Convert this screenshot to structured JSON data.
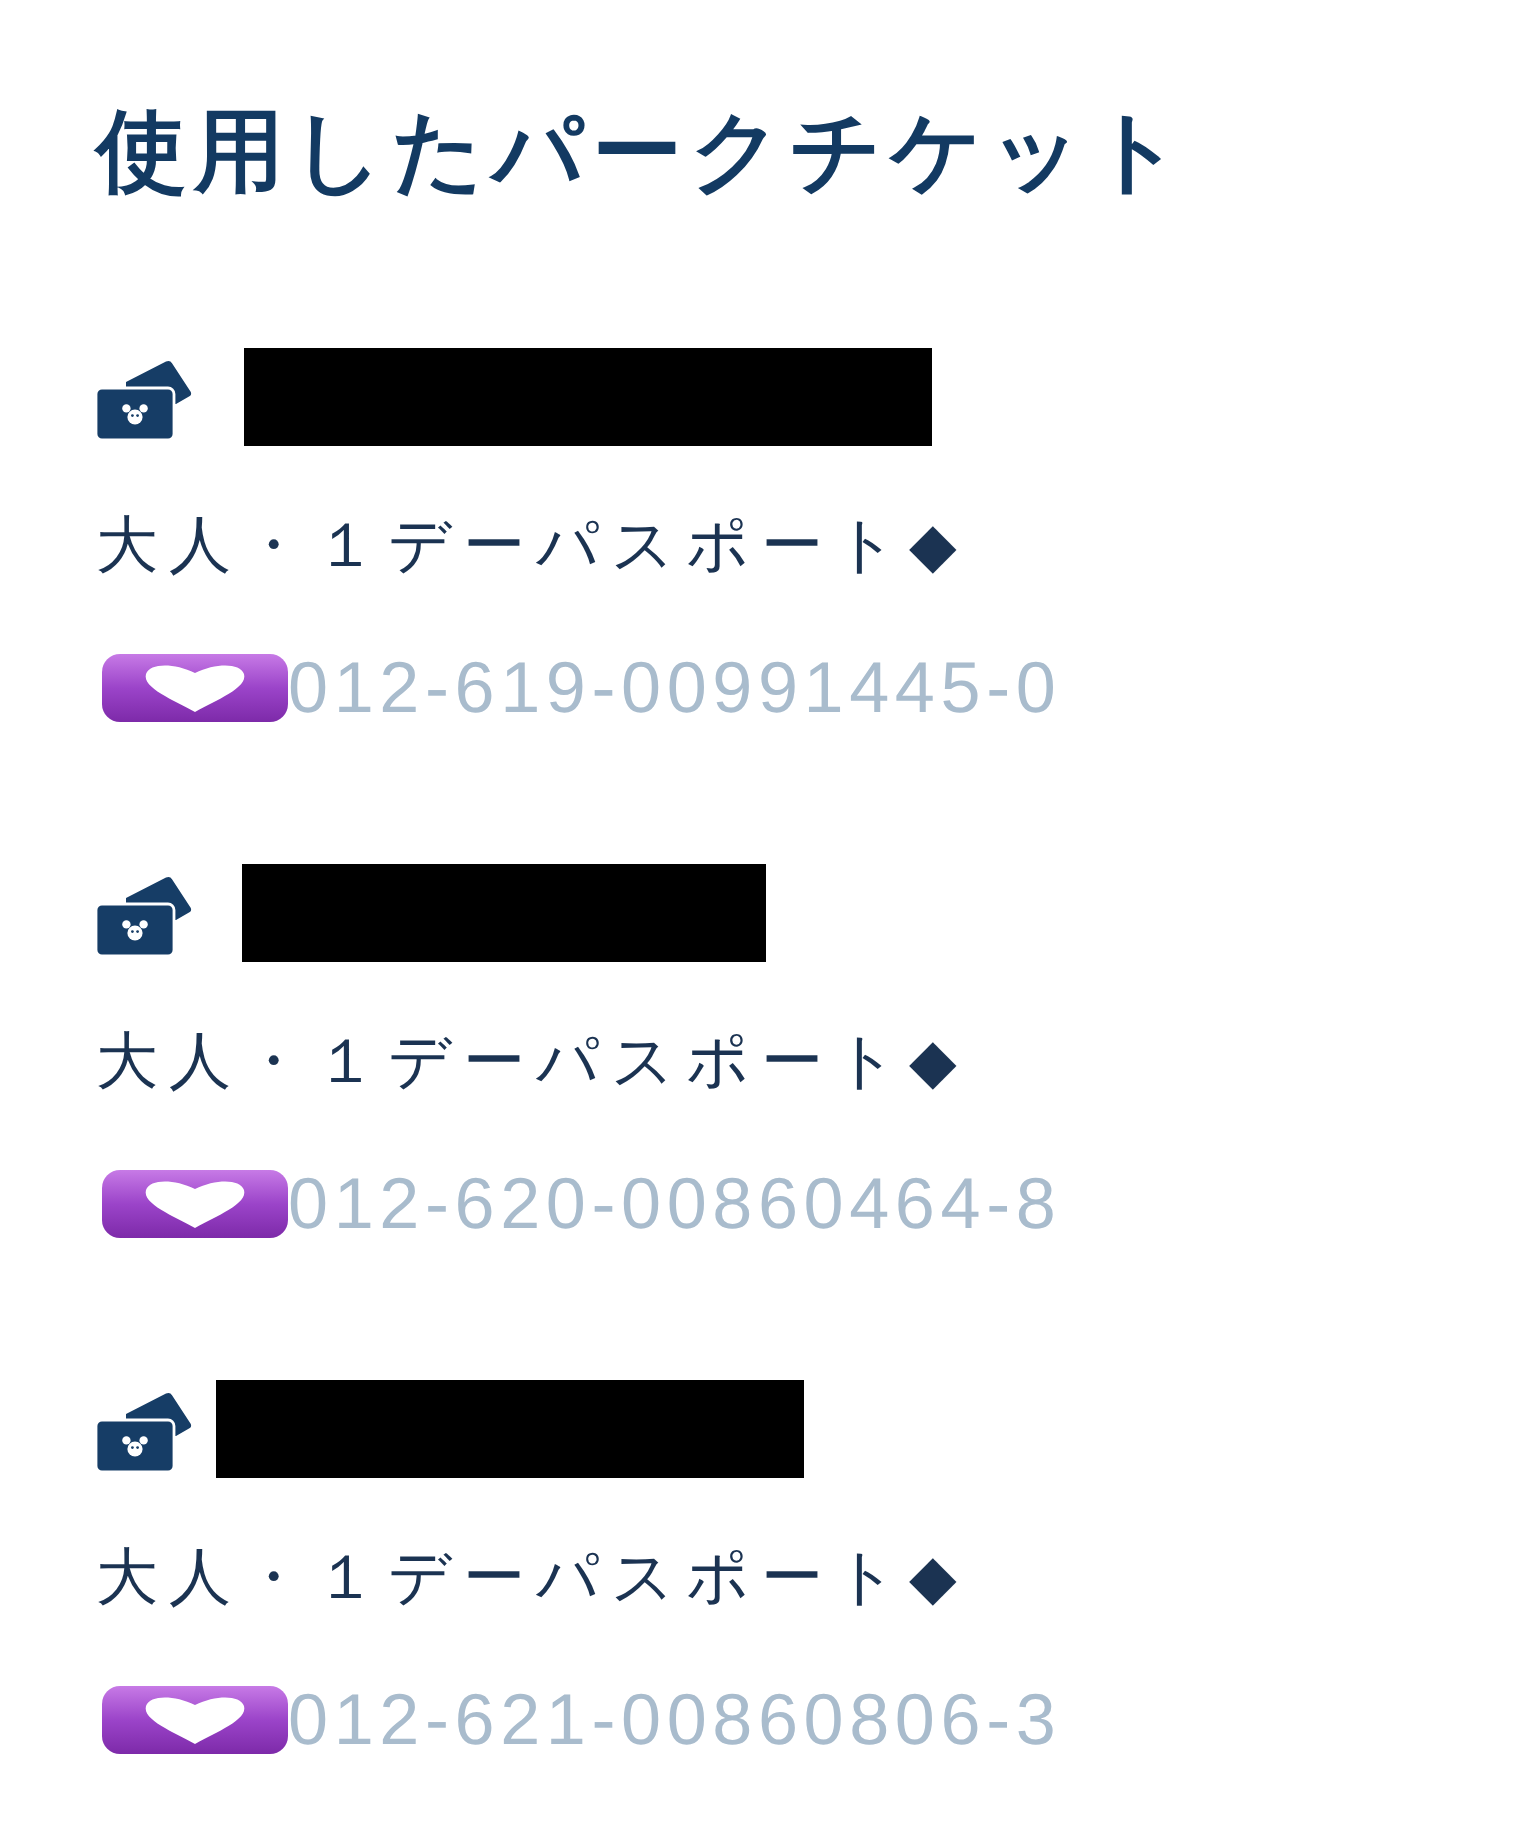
{
  "title": "使用したパークチケット",
  "tickets": [
    {
      "name_redacted": true,
      "ticket_type": "大人・１デーパスポート◆",
      "number_masked": true,
      "number": "012-619-00991445-0"
    },
    {
      "name_redacted": true,
      "ticket_type": "大人・１デーパスポート◆",
      "number_masked": true,
      "number": "012-620-00860464-8"
    },
    {
      "name_redacted": true,
      "ticket_type": "大人・１デーパスポート◆",
      "number_masked": true,
      "number": "012-621-00860806-3"
    }
  ]
}
